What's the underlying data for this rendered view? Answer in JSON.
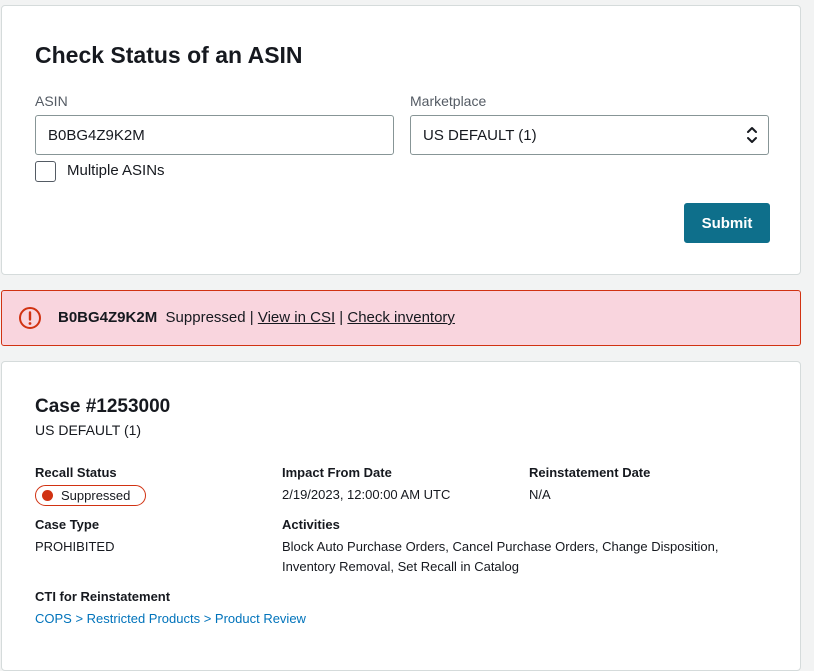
{
  "search": {
    "title": "Check Status of an ASIN",
    "asin_label": "ASIN",
    "asin_value": "B0BG4Z9K2M",
    "marketplace_label": "Marketplace",
    "marketplace_value": "US DEFAULT (1)",
    "multiple_label": "Multiple ASINs",
    "submit_label": "Submit"
  },
  "alert": {
    "asin": "B0BG4Z9K2M",
    "status": "Suppressed",
    "sep1": "|",
    "link1": "View in CSI",
    "sep2": "|",
    "link2": "Check inventory"
  },
  "case": {
    "title": "Case #1253000",
    "marketplace": "US DEFAULT (1)",
    "recall_status_label": "Recall Status",
    "recall_status_value": "Suppressed",
    "impact_label": "Impact From Date",
    "impact_value": "2/19/2023, 12:00:00 AM UTC",
    "reinstatement_label": "Reinstatement Date",
    "reinstatement_value": "N/A",
    "case_type_label": "Case Type",
    "case_type_value": "PROHIBITED",
    "activities_label": "Activities",
    "activities_line1": "Block Auto Purchase Orders, Cancel Purchase Orders, Change Disposition,",
    "activities_line2": "Inventory Removal, Set Recall in Catalog",
    "cti_label": "CTI for Reinstatement",
    "cti_value": "COPS > Restricted Products > Product Review"
  },
  "colors": {
    "accent": "#0e6f8b",
    "error": "#d13212",
    "alert_bg": "#f9d5de",
    "link": "#0073bb"
  }
}
